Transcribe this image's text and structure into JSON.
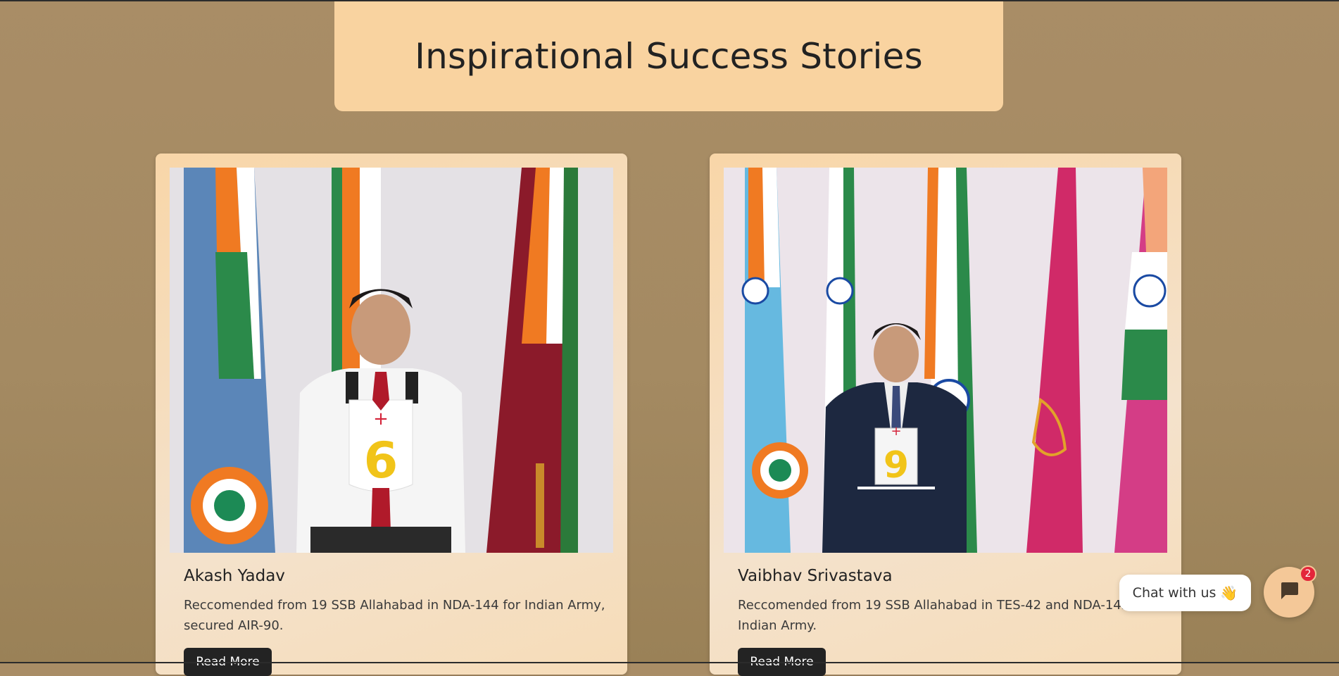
{
  "header": {
    "title": "Inspirational Success Stories"
  },
  "stories": [
    {
      "name": "Akash Yadav",
      "description": "Reccomended from 19 SSB Allahabad in NDA-144 for Indian Army, secured AIR-90.",
      "button_label": "Read More",
      "photo": "candidate-photo-with-flags",
      "chest_number": "6"
    },
    {
      "name": "Vaibhav Srivastava",
      "description": "Reccomended from 19 SSB Allahabad in TES-42 and NDA-145 for Indian Army.",
      "button_label": "Read More",
      "photo": "candidate-photo-with-flags",
      "chest_number": "9"
    }
  ],
  "chat": {
    "label": "Chat with us",
    "wave_emoji": "👋",
    "badge_count": "2",
    "icon": "chat-bubble-icon"
  },
  "colors": {
    "background": "#a98d66",
    "card": "#f8d6a8",
    "title_box": "#f9d3a0",
    "button": "#232323",
    "badge": "#e3263a"
  }
}
